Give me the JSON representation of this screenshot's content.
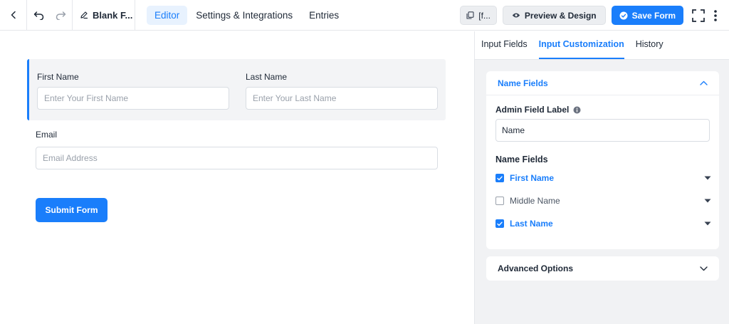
{
  "header": {
    "form_title": "Blank F...",
    "nav": [
      {
        "label": "Editor",
        "active": true
      },
      {
        "label": "Settings & Integrations",
        "active": false
      },
      {
        "label": "Entries",
        "active": false
      }
    ],
    "shortcode_label": "[f...",
    "preview_label": "Preview & Design",
    "save_label": "Save Form"
  },
  "form": {
    "first_name": {
      "label": "First Name",
      "placeholder": "Enter Your First Name"
    },
    "last_name": {
      "label": "Last Name",
      "placeholder": "Enter Your Last Name"
    },
    "email": {
      "label": "Email",
      "placeholder": "Email Address"
    },
    "submit_label": "Submit Form"
  },
  "panel": {
    "tabs": [
      {
        "label": "Input Fields",
        "active": false
      },
      {
        "label": "Input Customization",
        "active": true
      },
      {
        "label": "History",
        "active": false
      }
    ],
    "section_title": "Name Fields",
    "admin_label": "Admin Field Label",
    "admin_value": "Name",
    "name_fields_title": "Name Fields",
    "name_fields": [
      {
        "label": "First Name",
        "checked": true
      },
      {
        "label": "Middle Name",
        "checked": false
      },
      {
        "label": "Last Name",
        "checked": true
      }
    ],
    "advanced_label": "Advanced Options"
  },
  "colors": {
    "accent": "#1a7efb",
    "panel_bg": "#f1f2f4",
    "text": "#1f2937"
  }
}
